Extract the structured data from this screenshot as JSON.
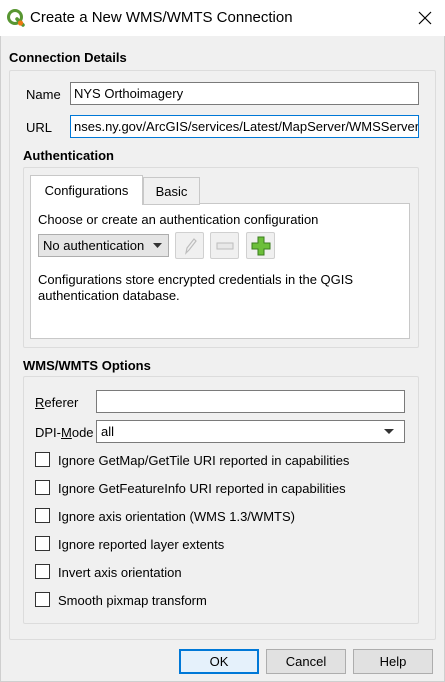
{
  "window": {
    "title": "Create a New WMS/WMTS Connection",
    "close_glyph": "✕"
  },
  "connection": {
    "section_title": "Connection Details",
    "name_label": "Name",
    "name_value": "NYS Orthoimagery",
    "url_label": "URL",
    "url_value": "nses.ny.gov/ArcGIS/services/Latest/MapServer/WMSServer?"
  },
  "auth": {
    "section_title": "Authentication",
    "tabs": [
      {
        "label": "Configurations",
        "active": true
      },
      {
        "label": "Basic",
        "active": false
      }
    ],
    "prompt": "Choose or create an authentication configuration",
    "selected_config": "No authentication",
    "info_line1": "Configurations store encrypted credentials in the QGIS",
    "info_line2": "authentication database."
  },
  "options": {
    "section_title": "WMS/WMTS Options",
    "referer_label_underlined": "R",
    "referer_label_rest": "eferer",
    "referer_value": "",
    "dpi_label_prefix": "DPI-",
    "dpi_label_underlined": "M",
    "dpi_label_rest": "ode",
    "dpi_value": "all",
    "checkboxes": [
      {
        "label": "Ignore GetMap/GetTile URI reported in capabilities",
        "checked": false
      },
      {
        "label": "Ignore GetFeatureInfo URI reported in capabilities",
        "checked": false
      },
      {
        "label": "Ignore axis orientation (WMS 1.3/WMTS)",
        "checked": false
      },
      {
        "label": "Ignore reported layer extents",
        "checked": false
      },
      {
        "label": "Invert axis orientation",
        "checked": false
      },
      {
        "label": "Smooth pixmap transform",
        "checked": false
      }
    ]
  },
  "buttons": {
    "ok": "OK",
    "cancel": "Cancel",
    "help": "Help"
  },
  "colors": {
    "accent": "#0078d7",
    "qgis_green": "#589632",
    "qgis_yellow": "#ee7913"
  }
}
